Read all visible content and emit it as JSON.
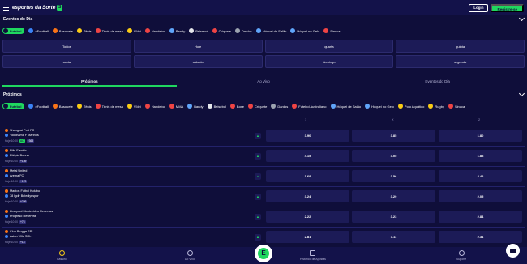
{
  "header": {
    "logo_text": "esportes da Sorte",
    "logo_badge": "S",
    "login_label": "Login",
    "register_label": "Registre-se"
  },
  "top_section": {
    "title": "Eventos do Dia",
    "sports": [
      {
        "label": "Futebol",
        "active": true,
        "color": "#0f0e3a"
      },
      {
        "label": "eFootball",
        "color": "#3b82f6"
      },
      {
        "label": "Basquete",
        "color": "#f97316"
      },
      {
        "label": "Tênis",
        "color": "#facc15"
      },
      {
        "label": "Tênis de mesa",
        "color": "#ef4444"
      },
      {
        "label": "Vôlei",
        "color": "#facc15"
      },
      {
        "label": "Handebol",
        "color": "#ef4444"
      },
      {
        "label": "Bandy",
        "color": "#60a5fa"
      },
      {
        "label": "Beisebol",
        "color": "#e5e7eb"
      },
      {
        "label": "Críquete",
        "color": "#ef4444"
      },
      {
        "label": "Dardos",
        "color": "#9ca3af"
      },
      {
        "label": "Hóquei de Salão",
        "color": "#60a5fa"
      },
      {
        "label": "Hóquei no Gelo",
        "color": "#60a5fa"
      },
      {
        "label": "Sinuca",
        "color": "#ef4444"
      }
    ],
    "days": [
      "Todos",
      "Hoje",
      "quarta",
      "quinta",
      "sexta",
      "sábado",
      "domingo",
      "segunda"
    ]
  },
  "tabs": [
    {
      "label": "Próximos",
      "active": true
    },
    {
      "label": "Ao Vivo"
    },
    {
      "label": "Eventos do Dia"
    }
  ],
  "proximos": {
    "title": "Próximos",
    "sports": [
      {
        "label": "Futebol",
        "active": true,
        "color": "#0f0e3a"
      },
      {
        "label": "eFootball",
        "color": "#3b82f6"
      },
      {
        "label": "Basquete",
        "color": "#f97316"
      },
      {
        "label": "Tênis",
        "color": "#facc15"
      },
      {
        "label": "Tênis de mesa",
        "color": "#ef4444"
      },
      {
        "label": "Vôlei",
        "color": "#facc15"
      },
      {
        "label": "Handebol",
        "color": "#ef4444"
      },
      {
        "label": "MMA",
        "color": "#ef4444"
      },
      {
        "label": "Bandy",
        "color": "#60a5fa"
      },
      {
        "label": "Beisebol",
        "color": "#e5e7eb"
      },
      {
        "label": "Boxe",
        "color": "#ef4444"
      },
      {
        "label": "Críquete",
        "color": "#ef4444"
      },
      {
        "label": "Dardos",
        "color": "#9ca3af"
      },
      {
        "label": "Futebol Australiano",
        "color": "#ef4444"
      },
      {
        "label": "Hóquei de Salão",
        "color": "#60a5fa"
      },
      {
        "label": "Hóquei no Gelo",
        "color": "#60a5fa"
      },
      {
        "label": "Polo Aquático",
        "color": "#facc15"
      },
      {
        "label": "Rugby",
        "color": "#facc15"
      },
      {
        "label": "Sinuca",
        "color": "#ef4444"
      }
    ],
    "col_heads": [
      "1",
      "X",
      "2"
    ],
    "events": [
      {
        "home": "Shanghai Port FC",
        "away": "Yokohama F Marinos",
        "time": "Hoje 10:00",
        "badge": "+363",
        "live": "AO",
        "odds": [
          "3.90",
          "3.85",
          "1.80"
        ]
      },
      {
        "home": "Etiis Electric",
        "away": "Etiópia Bunna",
        "time": "Hoje 10:00",
        "badge": "+139",
        "odds": [
          "4.15",
          "3.05",
          "1.88"
        ]
      },
      {
        "home": "Metal United",
        "away": "Arema FC",
        "time": "Hoje 10:00",
        "badge": "+170",
        "odds": [
          "1.68",
          "3.56",
          "4.42"
        ]
      },
      {
        "home": "Mantos Futbol Kulubu",
        "away": "78 Igdir Belediyespor",
        "time": "Hoje 10:00",
        "badge": "+226",
        "odds": [
          "3.24",
          "3.29",
          "2.05"
        ]
      },
      {
        "home": "Liverpool Montevideo Reservas",
        "away": "Progreso Reservas",
        "time": "Hoje 10:00",
        "badge": "+76",
        "odds": [
          "2.22",
          "3.23",
          "2.84"
        ]
      },
      {
        "home": "Club Brugge SRL",
        "away": "Aston Villa SRL",
        "time": "Hoje 10:00",
        "badge": "+14",
        "odds": [
          "2.81",
          "3.11",
          "2.31"
        ]
      }
    ]
  },
  "bottom_nav": {
    "items": [
      "Cassino",
      "Ao Vivo",
      "Histórico de Apostas",
      "Suporte"
    ],
    "center": "E"
  }
}
